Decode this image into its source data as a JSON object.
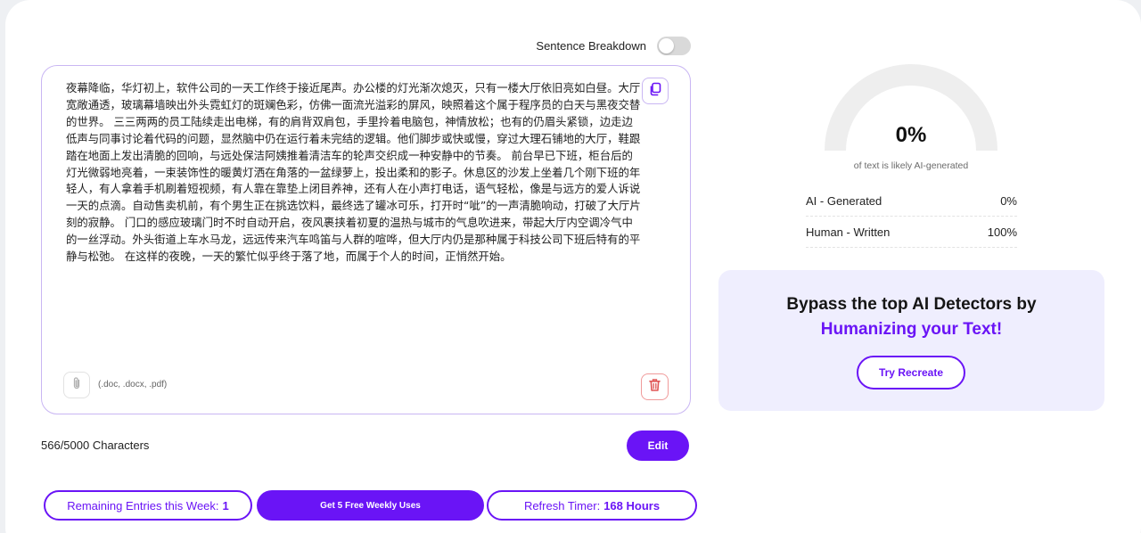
{
  "toggle": {
    "label": "Sentence Breakdown",
    "enabled": false
  },
  "editor": {
    "text": "夜幕降临，华灯初上，软件公司的一天工作终于接近尾声。办公楼的灯光渐次熄灭，只有一楼大厅依旧亮如白昼。大厅宽敞通透，玻璃幕墙映出外头霓虹灯的斑斓色彩，仿佛一面流光溢彩的屏风，映照着这个属于程序员的白天与黑夜交替的世界。 三三两两的员工陆续走出电梯，有的肩背双肩包，手里拎着电脑包，神情放松；也有的仍眉头紧锁，边走边低声与同事讨论着代码的问题，显然脑中仍在运行着未完结的逻辑。他们脚步或快或慢，穿过大理石铺地的大厅，鞋跟踏在地面上发出清脆的回响，与远处保洁阿姨推着清洁车的轮声交织成一种安静中的节奏。 前台早已下班，柜台后的灯光微弱地亮着，一束装饰性的暖黄灯洒在角落的一盆绿萝上，投出柔和的影子。休息区的沙发上坐着几个刚下班的年轻人，有人拿着手机刷着短视频，有人靠在靠垫上闭目养神，还有人在小声打电话，语气轻松，像是与远方的爱人诉说一天的点滴。自动售卖机前，有个男生正在挑选饮料，最终选了罐冰可乐，打开时“呲”的一声清脆响动，打破了大厅片刻的寂静。 门口的感应玻璃门时不时自动开启，夜风裹挟着初夏的温热与城市的气息吹进来，带起大厅内空调冷气中的一丝浮动。外头街道上车水马龙，远远传来汽车鸣笛与人群的喧哗，但大厅内仍是那种属于科技公司下班后特有的平静与松弛。 在这样的夜晚，一天的繁忙似乎终于落了地，而属于个人的时间，正悄然开始。",
    "file_hint": "(.doc, .docx, .pdf)"
  },
  "char_count": "566/5000 Characters",
  "edit_label": "Edit",
  "bottom": {
    "remaining_label": "Remaining Entries this Week:",
    "remaining_value": "1",
    "free_uses_label": "Get 5 Free Weekly Uses",
    "refresh_label": "Refresh Timer:",
    "refresh_value": "168 Hours"
  },
  "result": {
    "percent": "0%",
    "percent_value": 0,
    "caption": "of text is likely AI-generated",
    "rows": [
      {
        "label": "AI - Generated",
        "value": "0%"
      },
      {
        "label": "Human - Written",
        "value": "100%"
      }
    ]
  },
  "promo": {
    "line1": "Bypass the top AI Detectors by",
    "line2": "Humanizing your Text!",
    "button": "Try Recreate"
  },
  "colors": {
    "accent": "#6a14f6",
    "gauge_track": "#eeeeee",
    "promo_bg": "#efeefe",
    "delete": "#e05555"
  },
  "icons": [
    "copy-icon",
    "paperclip-icon",
    "trash-icon"
  ]
}
